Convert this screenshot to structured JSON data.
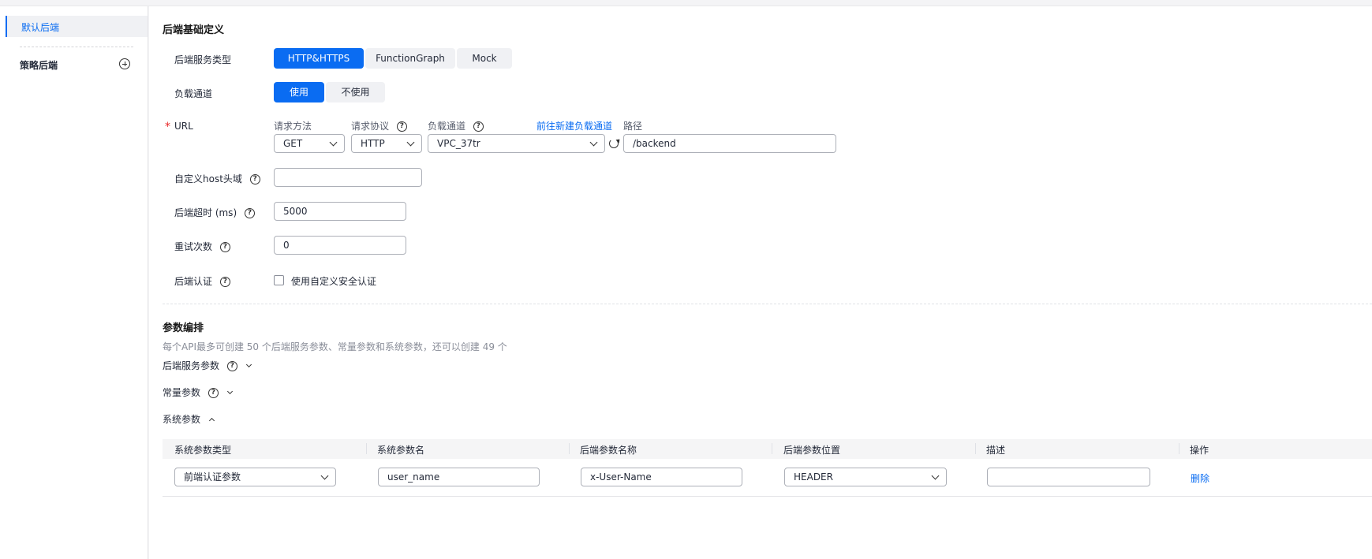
{
  "sidebar": {
    "active_item": "默认后端",
    "policy_label": "策略后端"
  },
  "basic": {
    "title": "后端基础定义",
    "service_type_label": "后端服务类型",
    "service_types": [
      "HTTP&HTTPS",
      "FunctionGraph",
      "Mock"
    ],
    "service_type_selected": "HTTP&HTTPS",
    "channel_label": "负载通道",
    "channel_options": [
      "使用",
      "不使用"
    ],
    "channel_selected": "使用",
    "url_required_mark": "*",
    "url_label": "URL",
    "method_label": "请求方法",
    "method_value": "GET",
    "protocol_label": "请求协议",
    "protocol_value": "HTTP",
    "vpc_label": "负载通道",
    "vpc_value": "VPC_37tr",
    "new_channel_link": "前往新建负载通道",
    "path_label": "路径",
    "path_value": "/backend",
    "host_label": "自定义host头域",
    "host_value": "",
    "timeout_label": "后端超时 (ms)",
    "timeout_value": "5000",
    "retry_label": "重试次数",
    "retry_value": "0",
    "auth_label": "后端认证",
    "auth_checkbox_label": "使用自定义安全认证"
  },
  "params": {
    "title": "参数编排",
    "hint": "每个API最多可创建 50 个后端服务参数、常量参数和系统参数，还可以创建 49 个",
    "backend_service_params": "后端服务参数",
    "constant_params": "常量参数",
    "system_params": "系统参数",
    "table": {
      "headers": [
        "系统参数类型",
        "系统参数名",
        "后端参数名称",
        "后端参数位置",
        "描述",
        "操作"
      ],
      "rows": [
        {
          "type": "前端认证参数",
          "name": "user_name",
          "backend_name": "x-User-Name",
          "location": "HEADER",
          "description": "",
          "action": "删除"
        }
      ]
    }
  },
  "icons": {
    "help": "?"
  }
}
